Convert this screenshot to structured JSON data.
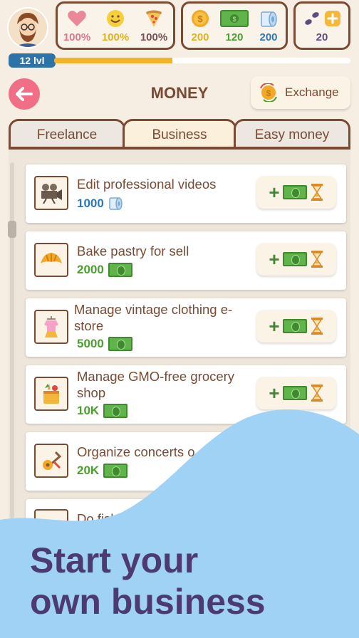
{
  "stats": {
    "health": "100%",
    "mood": "100%",
    "food": "100%",
    "coins": "200",
    "money": "120",
    "paper": "200",
    "steps": "20"
  },
  "level": {
    "label": "12 lvl",
    "progress": 0.4
  },
  "header": {
    "title": "MONEY",
    "exchange_label": "Exchange"
  },
  "tabs": [
    {
      "label": "Freelance",
      "active": false
    },
    {
      "label": "Business",
      "active": true
    },
    {
      "label": "Easy money",
      "active": false
    }
  ],
  "jobs": [
    {
      "title": "Edit professional videos",
      "amount": "1000",
      "currency": "paper-icon",
      "amount_color": "#2979b8"
    },
    {
      "title": "Bake pastry for sell",
      "amount": "2000",
      "currency": "bill-icon",
      "amount_color": "#4aa02f"
    },
    {
      "title": "Manage vintage clothing e-store",
      "amount": "5000",
      "currency": "bill-icon",
      "amount_color": "#4aa02f"
    },
    {
      "title": "Manage GMO-free grocery shop",
      "amount": "10K",
      "currency": "bill-icon",
      "amount_color": "#4aa02f"
    },
    {
      "title": "Organize concerts o",
      "amount": "20K",
      "currency": "bill-icon",
      "amount_color": "#4aa02f"
    },
    {
      "title": "Do fish fa",
      "amount": "",
      "currency": "",
      "amount_color": "#4aa02f"
    }
  ],
  "promo": {
    "line1": "Start your",
    "line2": "own business"
  },
  "colors": {
    "brown": "#7a4a33",
    "pink": "#f06f86",
    "green": "#4aa02f",
    "blue": "#2979b8",
    "wave": "#9fd2f4",
    "promo_text": "#4d3a72"
  }
}
